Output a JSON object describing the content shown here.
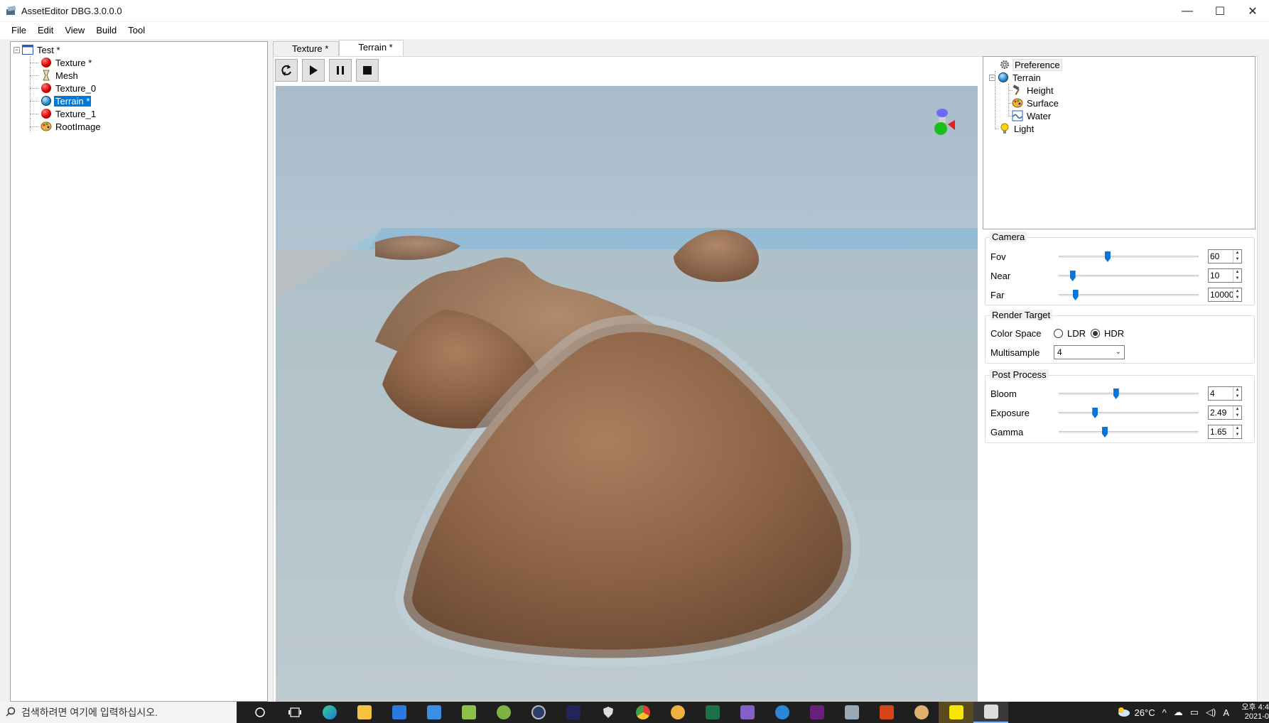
{
  "window": {
    "title": "AssetEditor DBG.3.0.0.0",
    "min": "—",
    "max": "☐",
    "close": "✕"
  },
  "menu": [
    "File",
    "Edit",
    "View",
    "Build",
    "Tool"
  ],
  "left_tree": {
    "root": "Test *",
    "items": [
      {
        "label": "Texture *",
        "icon": "red-sphere-icon"
      },
      {
        "label": "Mesh",
        "icon": "mesh-icon"
      },
      {
        "label": "Texture_0",
        "icon": "red-sphere-icon"
      },
      {
        "label": "Terrain *",
        "icon": "globe-icon",
        "selected": true
      },
      {
        "label": "Texture_1",
        "icon": "red-sphere-icon"
      },
      {
        "label": "RootImage",
        "icon": "palette-icon"
      }
    ]
  },
  "tabs": [
    {
      "label": "Texture *",
      "active": false
    },
    {
      "label": "Terrain *",
      "active": true
    }
  ],
  "toolbar": {
    "refresh": "refresh-icon",
    "play": "play-icon",
    "pause": "pause-icon",
    "stop": "stop-icon"
  },
  "right_tree": {
    "preference": "Preference",
    "terrain": "Terrain",
    "children": [
      "Height",
      "Surface",
      "Water"
    ],
    "light": "Light"
  },
  "camera": {
    "title": "Camera",
    "fov": {
      "label": "Fov",
      "value": "60",
      "level": 0.35
    },
    "near": {
      "label": "Near",
      "value": "10",
      "level": 0.1
    },
    "far": {
      "label": "Far",
      "value": "10000",
      "level": 0.12
    }
  },
  "render_target": {
    "title": "Render Target",
    "color_space_label": "Color Space",
    "ldr": "LDR",
    "hdr": "HDR",
    "selected": "HDR",
    "multisample_label": "Multisample",
    "multisample_value": "4"
  },
  "post_process": {
    "title": "Post Process",
    "bloom": {
      "label": "Bloom",
      "value": "4",
      "level": 0.41
    },
    "exposure": {
      "label": "Exposure",
      "value": "2.49",
      "level": 0.26
    },
    "gamma": {
      "label": "Gamma",
      "value": "1.65",
      "level": 0.33
    }
  },
  "taskbar": {
    "search_placeholder": "검색하려면 여기에 입력하십시오.",
    "temperature": "26°C",
    "time": "오후 4:4",
    "date": "2021-0"
  },
  "colors": {
    "accent": "#0078d7",
    "slider": "#0a74d6",
    "taskbar": "#1f1f1f"
  }
}
